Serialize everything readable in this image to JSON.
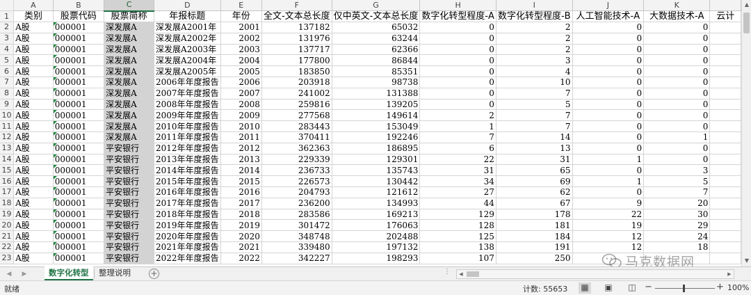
{
  "columns": [
    {
      "letter": "",
      "width": 20
    },
    {
      "letter": "A",
      "width": 67
    },
    {
      "letter": "B",
      "width": 80
    },
    {
      "letter": "C",
      "width": 78
    },
    {
      "letter": "D",
      "width": 80
    },
    {
      "letter": "E",
      "width": 69
    },
    {
      "letter": "F",
      "width": 99
    },
    {
      "letter": "G",
      "width": 118
    },
    {
      "letter": "H",
      "width": 108
    },
    {
      "letter": "I",
      "width": 109
    },
    {
      "letter": "J",
      "width": 105
    },
    {
      "letter": "K",
      "width": 100
    },
    {
      "letter": "",
      "width": 50
    }
  ],
  "selected_column": "C",
  "headers": [
    "类别",
    "股票代码",
    "股票简称",
    "年报标题",
    "年份",
    "全文-文本总长度",
    "仅中英文-文本总长度",
    "数字化转型程度-A",
    "数字化转型程度-B",
    "人工智能技术-A",
    "大数据技术-A",
    "云计"
  ],
  "rows": [
    [
      "A股",
      "000001",
      "深发展A",
      "深发展A2001年",
      "2001",
      "137182",
      "65032",
      "0",
      "2",
      "0",
      "0"
    ],
    [
      "A股",
      "000001",
      "深发展A",
      "深发展A2002年",
      "2002",
      "131976",
      "63244",
      "0",
      "2",
      "0",
      "0"
    ],
    [
      "A股",
      "000001",
      "深发展A",
      "深发展A2003年",
      "2003",
      "137717",
      "62366",
      "0",
      "2",
      "0",
      "0"
    ],
    [
      "A股",
      "000001",
      "深发展A",
      "深发展A2004年",
      "2004",
      "177800",
      "86844",
      "0",
      "3",
      "0",
      "0"
    ],
    [
      "A股",
      "000001",
      "深发展A",
      "深发展A2005年",
      "2005",
      "183850",
      "85351",
      "0",
      "4",
      "0",
      "0"
    ],
    [
      "A股",
      "000001",
      "深发展A",
      "2006年年度报告",
      "2006",
      "203918",
      "98738",
      "0",
      "10",
      "0",
      "0"
    ],
    [
      "A股",
      "000001",
      "深发展A",
      "2007年年度报告",
      "2007",
      "241002",
      "131388",
      "0",
      "7",
      "0",
      "0"
    ],
    [
      "A股",
      "000001",
      "深发展A",
      "2008年年度报告",
      "2008",
      "259816",
      "139205",
      "0",
      "5",
      "0",
      "0"
    ],
    [
      "A股",
      "000001",
      "深发展A",
      "2009年年度报告",
      "2009",
      "277568",
      "149614",
      "2",
      "7",
      "0",
      "0"
    ],
    [
      "A股",
      "000001",
      "深发展A",
      "2010年年度报告",
      "2010",
      "283443",
      "153049",
      "1",
      "7",
      "0",
      "0"
    ],
    [
      "A股",
      "000001",
      "深发展A",
      "2011年年度报告",
      "2011",
      "370411",
      "192246",
      "7",
      "14",
      "0",
      "1"
    ],
    [
      "A股",
      "000001",
      "平安银行",
      "2012年年度报告",
      "2012",
      "362363",
      "186895",
      "6",
      "13",
      "0",
      "0"
    ],
    [
      "A股",
      "000001",
      "平安银行",
      "2013年年度报告",
      "2013",
      "229339",
      "129301",
      "22",
      "31",
      "1",
      "0"
    ],
    [
      "A股",
      "000001",
      "平安银行",
      "2014年年度报告",
      "2014",
      "236733",
      "135743",
      "31",
      "65",
      "0",
      "3"
    ],
    [
      "A股",
      "000001",
      "平安银行",
      "2015年年度报告",
      "2015",
      "226573",
      "130442",
      "34",
      "69",
      "1",
      "5"
    ],
    [
      "A股",
      "000001",
      "平安银行",
      "2016年年度报告",
      "2016",
      "204793",
      "121612",
      "27",
      "62",
      "0",
      "7"
    ],
    [
      "A股",
      "000001",
      "平安银行",
      "2017年年度报告",
      "2017",
      "236200",
      "134993",
      "44",
      "67",
      "9",
      "20"
    ],
    [
      "A股",
      "000001",
      "平安银行",
      "2018年年度报告",
      "2018",
      "283586",
      "169213",
      "129",
      "178",
      "22",
      "30"
    ],
    [
      "A股",
      "000001",
      "平安银行",
      "2019年年度报告",
      "2019",
      "301472",
      "176063",
      "128",
      "181",
      "19",
      "29"
    ],
    [
      "A股",
      "000001",
      "平安银行",
      "2020年年度报告",
      "2020",
      "348748",
      "202488",
      "125",
      "184",
      "12",
      "24"
    ],
    [
      "A股",
      "000001",
      "平安银行",
      "2021年年度报告",
      "2021",
      "339480",
      "197132",
      "138",
      "191",
      "12",
      "18"
    ],
    [
      "A股",
      "000001",
      "平安银行",
      "2022年年度报告",
      "2022",
      "342227",
      "198293",
      "107",
      "250",
      "",
      ""
    ]
  ],
  "sheet_tabs": [
    "数字化转型",
    "整理说明"
  ],
  "active_tab": "数字化转型",
  "status": {
    "ready": "就绪",
    "count": "计数: 55653",
    "zoom": "100%"
  },
  "watermark": "马克数据网"
}
